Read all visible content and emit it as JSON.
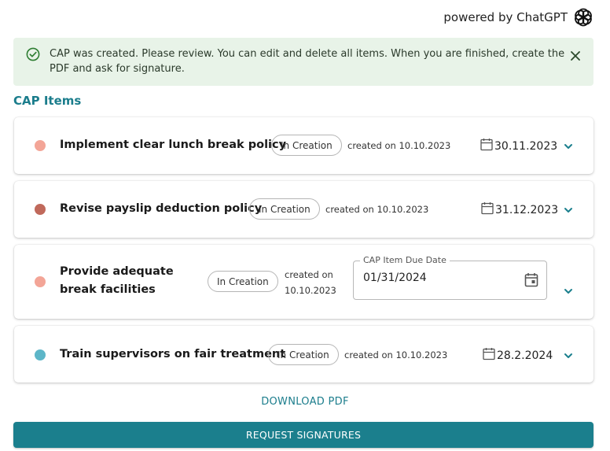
{
  "header": {
    "powered_by": "powered by ChatGPT",
    "logo_icon": "openai-logo-icon"
  },
  "alert": {
    "message": "CAP was created. Please review. You can edit and delete all items. When you are finished, create the PDF and ask for signature.",
    "color": "#e8f3e8",
    "icon": "check-circle-icon",
    "close_icon": "close-icon"
  },
  "section_title": "CAP Items",
  "items": [
    {
      "title": "Implement clear lunch break policy",
      "status": "In Creation",
      "created": "created on 10.10.2023",
      "due": "30.11.2023",
      "dot_color": "#f3a597"
    },
    {
      "title": "Revise payslip deduction policy",
      "status": "In Creation",
      "created": "created on 10.10.2023",
      "due": "31.12.2023",
      "dot_color": "#c0695b"
    },
    {
      "title": "Provide adequate break facilities",
      "status": "In Creation",
      "created": "created on 10.10.2023",
      "due_label": "CAP Item Due Date",
      "due_value": "01/31/2024",
      "dot_color": "#f3a597"
    },
    {
      "title": "Train supervisors on fair treatment",
      "status": "In Creation",
      "created": "created on 10.10.2023",
      "due": "28.2.2024",
      "dot_color": "#5db6c8"
    }
  ],
  "actions": {
    "download": "DOWNLOAD PDF",
    "request": "REQUEST SIGNATURES",
    "accent": "#1b7f8d"
  }
}
